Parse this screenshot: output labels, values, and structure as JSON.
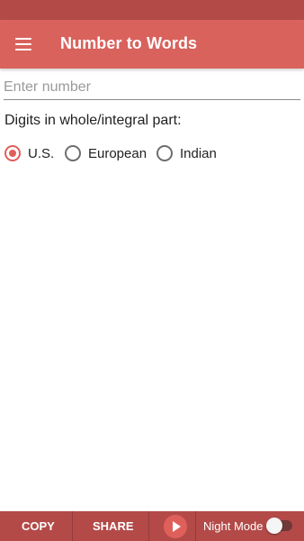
{
  "colors": {
    "status_bar": "#b34a48",
    "app_bar": "#d9625d",
    "accent": "#df605b",
    "bottom_bar": "#b34a48"
  },
  "app_bar": {
    "menu_icon": "hamburger-menu-icon",
    "title": "Number to Words"
  },
  "input": {
    "placeholder": "Enter number",
    "value": ""
  },
  "digits": {
    "label": "Digits in whole/integral part:",
    "options": [
      {
        "label": "U.S.",
        "checked": true
      },
      {
        "label": "European",
        "checked": false
      },
      {
        "label": "Indian",
        "checked": false
      }
    ]
  },
  "bottom_bar": {
    "copy_label": "COPY",
    "share_label": "SHARE",
    "play_icon": "play-icon",
    "night_mode_label": "Night Mode",
    "night_mode_on": false
  }
}
